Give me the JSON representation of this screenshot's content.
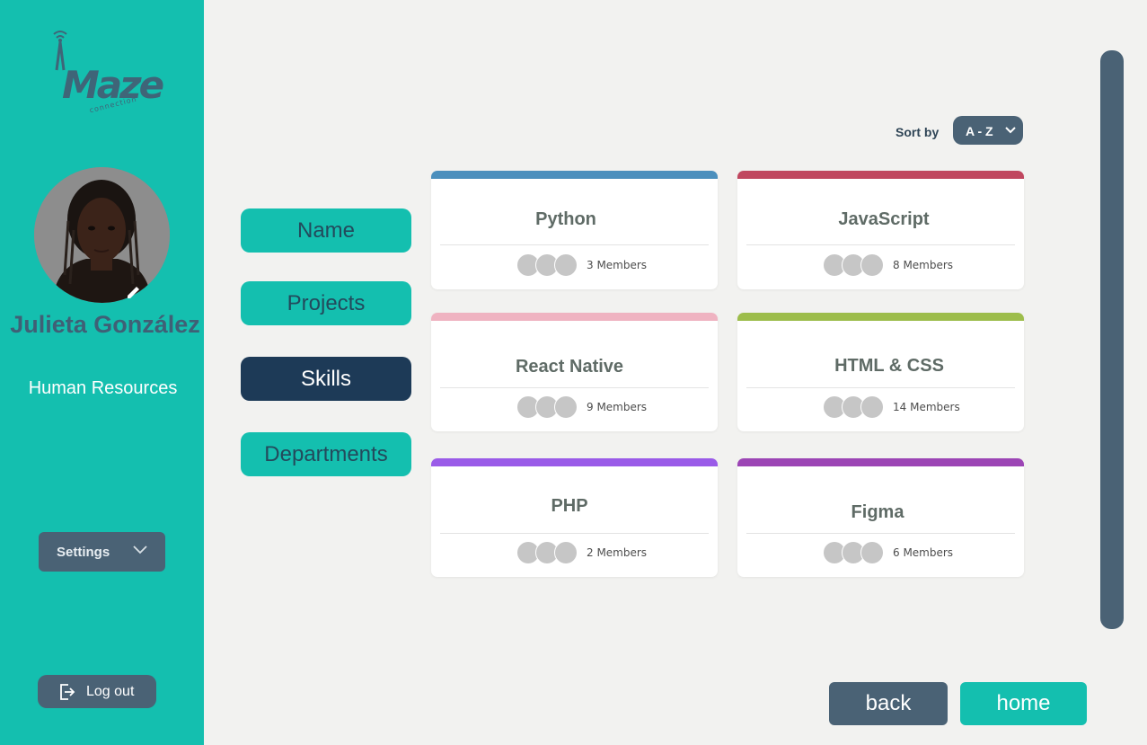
{
  "brand": {
    "logo_text": "Maze",
    "logo_subtext": "connection"
  },
  "user": {
    "name": "Julieta González",
    "department": "Human Resources"
  },
  "sidebar": {
    "settings_label": "Settings",
    "logout_label": "Log out"
  },
  "categories": [
    {
      "label": "Name",
      "active": false
    },
    {
      "label": "Projects",
      "active": false
    },
    {
      "label": "Skills",
      "active": true
    },
    {
      "label": "Departments",
      "active": false
    }
  ],
  "sort": {
    "label": "Sort by",
    "value": "A - Z"
  },
  "skills": [
    {
      "title": "Python",
      "members": "3 Members",
      "color": "#4b8fbd"
    },
    {
      "title": "JavaScript",
      "members": "8 Members",
      "color": "#c0475f"
    },
    {
      "title": "React Native",
      "members": "9 Members",
      "color": "#efb3c1"
    },
    {
      "title": "HTML & CSS",
      "members": "14 Members",
      "color": "#9dbd4b"
    },
    {
      "title": "PHP",
      "members": "2 Members",
      "color": "#9a5be8"
    },
    {
      "title": "Figma",
      "members": "6 Members",
      "color": "#9c45b5"
    }
  ],
  "nav": {
    "back_label": "back",
    "home_label": "home"
  },
  "colors": {
    "sidebar": "#14bfaf",
    "primary_dark": "#4a6275",
    "active_tab": "#1d3a57",
    "background": "#f2f2f0"
  }
}
